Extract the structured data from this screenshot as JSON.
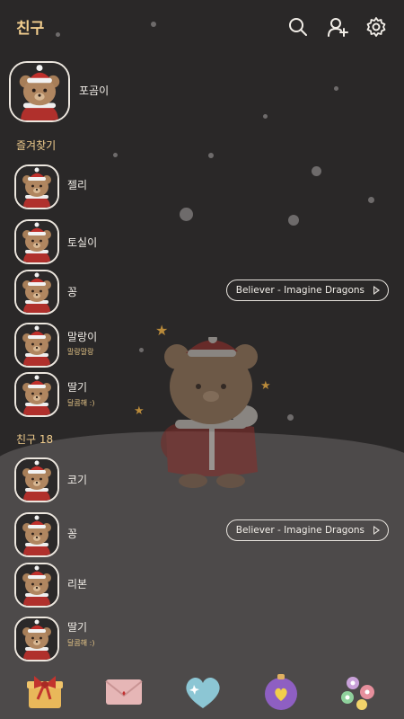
{
  "header": {
    "title": "친구"
  },
  "me": {
    "name": "포곰이"
  },
  "favorites": {
    "section_label": "즐겨찾기",
    "items": [
      {
        "name": "젤리",
        "status": ""
      },
      {
        "name": "토실이",
        "status": ""
      },
      {
        "name": "꽁",
        "status": "",
        "music": "Believer - Imagine Dragons"
      },
      {
        "name": "말랑이",
        "status": "말랑말랑"
      },
      {
        "name": "딸기",
        "status": "달콤해 :)"
      }
    ]
  },
  "friends": {
    "section_label": "친구 18",
    "items": [
      {
        "name": "코기",
        "status": ""
      },
      {
        "name": "꽁",
        "status": "",
        "music": "Believer - Imagine Dragons"
      },
      {
        "name": "리본",
        "status": ""
      },
      {
        "name": "딸기",
        "status": "달콤해 :)"
      }
    ]
  },
  "icons": {
    "search": "search-icon",
    "add_friend": "add-friend-icon",
    "settings": "gear-icon"
  },
  "tabs": [
    "gift-box-icon",
    "letter-icon",
    "heart-icon",
    "ornament-icon",
    "flowers-icon"
  ],
  "colors": {
    "accent": "#f2ce8e",
    "background": "#2a2828",
    "ground": "#4d4a4a",
    "text": "#f2eee8"
  }
}
